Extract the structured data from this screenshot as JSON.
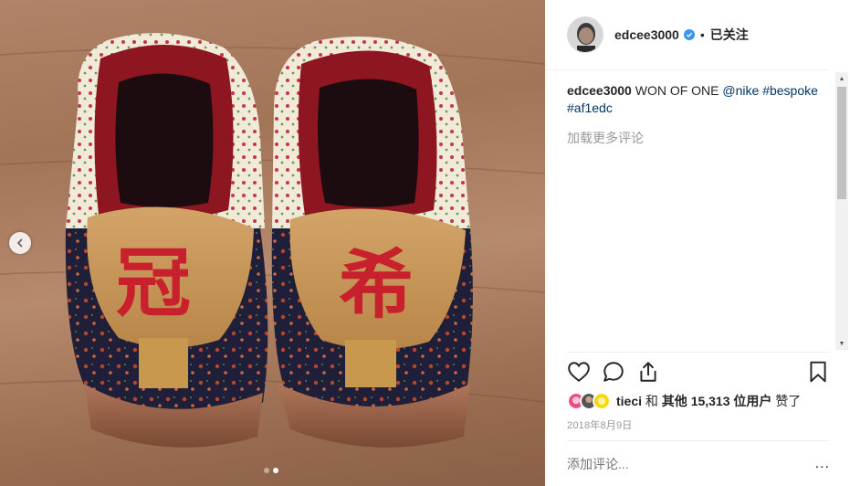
{
  "post": {
    "username": "edcee3000",
    "separator": "•",
    "follow_label": "已关注",
    "caption_user": "edcee3000",
    "caption_text": "WON OF ONE",
    "mention": "@nike",
    "hashtags": [
      "#bespoke",
      "#af1edc"
    ],
    "load_more": "加载更多评论",
    "likes": {
      "first_user": "tieci",
      "connector": "和",
      "others_prefix": "其他",
      "count": "15,313",
      "others_suffix": "位用户",
      "liked": "赞了"
    },
    "date": "2018年8月9日",
    "add_comment_placeholder": "添加评论...",
    "more_options": "..."
  },
  "photo": {
    "left_char": "冠",
    "right_char": "希",
    "carousel_count": 2,
    "carousel_active": 2
  },
  "icons": {
    "like": "heart-icon",
    "comment": "comment-icon",
    "share": "share-icon",
    "save": "bookmark-icon",
    "verified": "verified-badge-icon",
    "prev": "chevron-left-icon"
  },
  "colors": {
    "link": "#003569",
    "muted": "#999999",
    "verified": "#3897f0",
    "embroidery": "#c8202c"
  }
}
